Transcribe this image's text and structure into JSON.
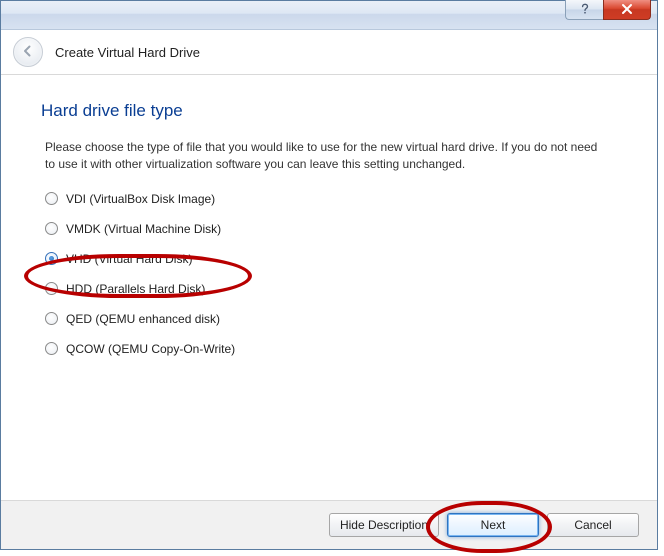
{
  "titlebar": {
    "help_tooltip": "Help",
    "close_tooltip": "Close"
  },
  "header": {
    "back_tooltip": "Back",
    "wizard_title": "Create Virtual Hard Drive"
  },
  "page": {
    "heading": "Hard drive file type",
    "description": "Please choose the type of file that you would like to use for the new virtual hard drive. If you do not need to use it with other virtualization software you can leave this setting unchanged."
  },
  "options": [
    {
      "id": "vdi",
      "label": "VDI (VirtualBox Disk Image)",
      "selected": false
    },
    {
      "id": "vmdk",
      "label": "VMDK (Virtual Machine Disk)",
      "selected": false
    },
    {
      "id": "vhd",
      "label": "VHD (Virtual Hard Disk)",
      "selected": true
    },
    {
      "id": "hdd",
      "label": "HDD (Parallels Hard Disk)",
      "selected": false
    },
    {
      "id": "qed",
      "label": "QED (QEMU enhanced disk)",
      "selected": false
    },
    {
      "id": "qcow",
      "label": "QCOW (QEMU Copy-On-Write)",
      "selected": false
    }
  ],
  "footer": {
    "hide_description_label": "Hide Description",
    "next_label": "Next",
    "cancel_label": "Cancel"
  },
  "annotations": {
    "highlighted_option": "vhd",
    "highlighted_button": "next"
  }
}
